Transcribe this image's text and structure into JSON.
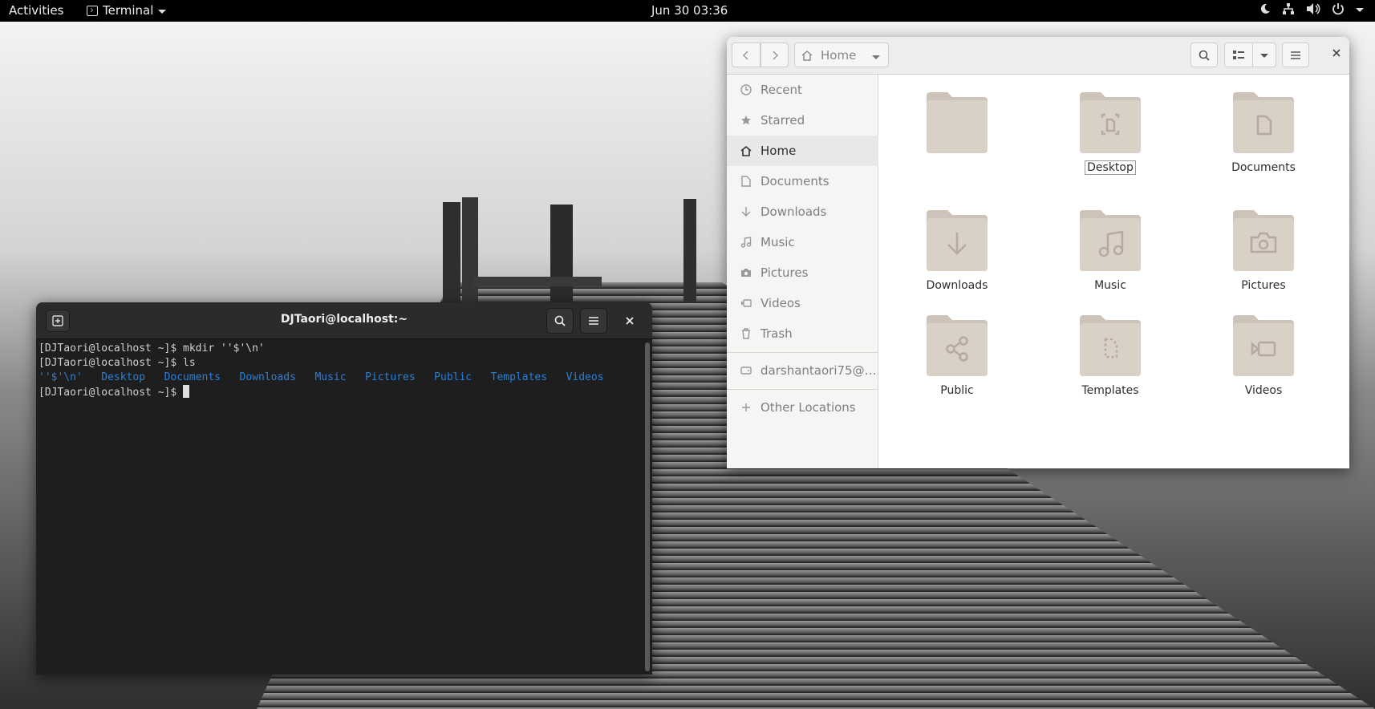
{
  "topbar": {
    "activities": "Activities",
    "app_name": "Terminal",
    "clock": "Jun 30  03:36"
  },
  "terminal": {
    "title": "DJTaori@localhost:~",
    "lines": [
      "[DJTaori@localhost ~]$ mkdir ''$'\\n'",
      "[DJTaori@localhost ~]$ ls"
    ],
    "ls_output": [
      "''$'\\n'",
      "Desktop",
      "Documents",
      "Downloads",
      "Music",
      "Pictures",
      "Public",
      "Templates",
      "Videos"
    ],
    "prompt": "[DJTaori@localhost ~]$ ",
    "colors": {
      "bg": "#1e1e1e",
      "ls_dir": "#2a7fd8"
    }
  },
  "files": {
    "path": "Home",
    "sidebar": [
      {
        "label": "Recent",
        "icon": "clock-icon"
      },
      {
        "label": "Starred",
        "icon": "star-icon"
      },
      {
        "label": "Home",
        "icon": "home-icon"
      },
      {
        "label": "Documents",
        "icon": "document-icon"
      },
      {
        "label": "Downloads",
        "icon": "download-icon"
      },
      {
        "label": "Music",
        "icon": "music-icon"
      },
      {
        "label": "Pictures",
        "icon": "camera-icon"
      },
      {
        "label": "Videos",
        "icon": "video-icon"
      },
      {
        "label": "Trash",
        "icon": "trash-icon"
      },
      {
        "label": "darshantaori75@…",
        "icon": "drive-icon"
      },
      {
        "label": "Other Locations",
        "icon": "plus-icon"
      }
    ],
    "folders": [
      {
        "label": "",
        "icon": "folder-icon"
      },
      {
        "label": "Desktop",
        "icon": "desktop-folder-icon"
      },
      {
        "label": "Documents",
        "icon": "documents-folder-icon"
      },
      {
        "label": "Downloads",
        "icon": "downloads-folder-icon"
      },
      {
        "label": "Music",
        "icon": "music-folder-icon"
      },
      {
        "label": "Pictures",
        "icon": "pictures-folder-icon"
      },
      {
        "label": "Public",
        "icon": "public-folder-icon"
      },
      {
        "label": "Templates",
        "icon": "templates-folder-icon"
      },
      {
        "label": "Videos",
        "icon": "videos-folder-icon"
      }
    ],
    "colors": {
      "folder": "#d9d0c6",
      "folder_tab": "#cdc3b8",
      "folder_glyph": "#b5aa9d"
    }
  }
}
